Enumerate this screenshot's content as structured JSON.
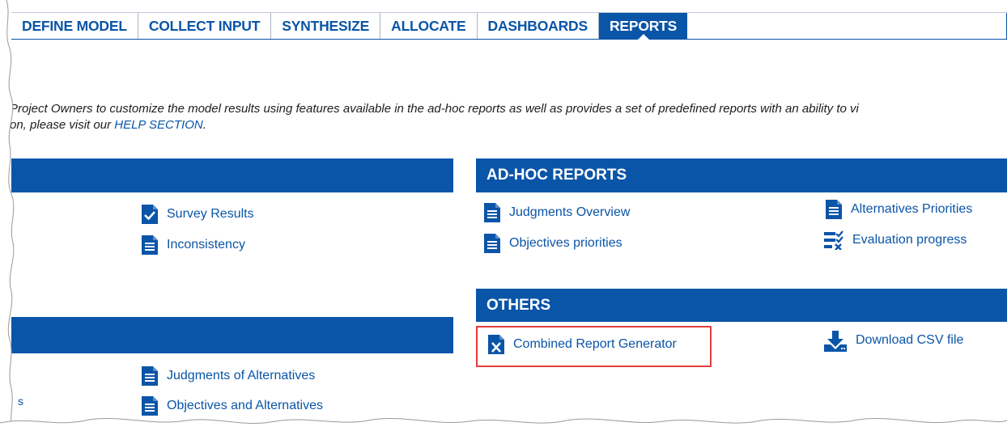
{
  "nav": {
    "tabs": [
      {
        "label": "DEFINE MODEL",
        "active": false
      },
      {
        "label": "COLLECT INPUT",
        "active": false
      },
      {
        "label": "SYNTHESIZE",
        "active": false
      },
      {
        "label": "ALLOCATE",
        "active": false
      },
      {
        "label": "DASHBOARDS",
        "active": false
      },
      {
        "label": "REPORTS",
        "active": true
      }
    ]
  },
  "intro": {
    "line1": "Project Owners to customize the model results using features available in the ad-hoc reports as well as provides a set of predefined reports with an ability to vi",
    "line2_prefix": "on, please visit our ",
    "help_link": "HELP SECTION",
    "line2_suffix": "."
  },
  "left_panel": {
    "items_top": [
      {
        "label": "Survey Results",
        "icon": "check-document-icon"
      },
      {
        "label": "Inconsistency",
        "icon": "document-icon"
      }
    ],
    "items_bottom": [
      {
        "label": "Judgments of Alternatives",
        "icon": "document-icon"
      },
      {
        "label": "Objectives and Alternatives",
        "icon": "document-icon"
      }
    ],
    "stub_text": "s"
  },
  "adhoc": {
    "title": "AD-HOC REPORTS",
    "items": [
      {
        "label": "Judgments Overview",
        "icon": "document-icon"
      },
      {
        "label": "Objectives priorities",
        "icon": "document-icon"
      },
      {
        "label": "Alternatives Priorities",
        "icon": "document-icon"
      },
      {
        "label": "Evaluation progress",
        "icon": "checklist-icon"
      }
    ]
  },
  "others": {
    "title": "OTHERS",
    "items": [
      {
        "label": "Combined Report Generator",
        "icon": "excel-document-icon",
        "highlighted": true
      },
      {
        "label": "Download CSV file",
        "icon": "download-icon"
      }
    ]
  },
  "colors": {
    "accent": "#0a55a8",
    "highlight": "#e23d3d",
    "text": "#1d1d1d"
  }
}
